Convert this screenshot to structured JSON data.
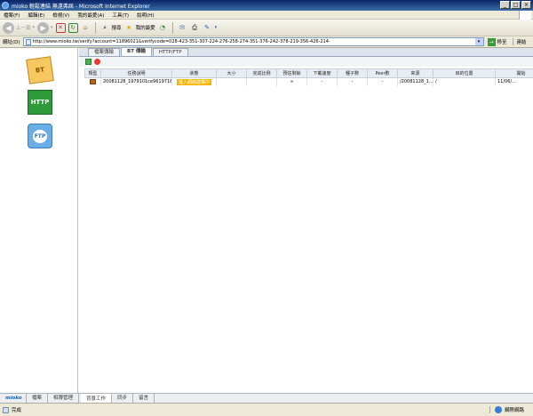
{
  "window": {
    "title": "mioko 輕鬆連結 無遠弗屆 - Microsoft Internet Explorer"
  },
  "menu": [
    "檔案(F)",
    "編輯(E)",
    "檢視(V)",
    "我的最愛(A)",
    "工具(T)",
    "說明(H)"
  ],
  "toolbar": {
    "back": "上一頁",
    "search": "搜尋",
    "favorites": "我的最愛"
  },
  "address": {
    "label": "網址(D)",
    "url": "http://www.mioko.tw/verify?account=11896021&verifycode=028-423-351-307-224-276-258-274-351-376-242-378-219-356-426-214-",
    "go": "移至",
    "links": "連結"
  },
  "sidebar": [
    "BT",
    "HTTP",
    "FTP"
  ],
  "tabs": [
    "檔案傳輸",
    "BT 傳輸",
    "HTTP/FTP"
  ],
  "table": {
    "columns": [
      "類型",
      "任務說明",
      "狀態",
      "大小",
      "完成比例",
      "預估剩餘",
      "下載速度",
      "種子數",
      "Peer數",
      "來源",
      "目的位置",
      "開始"
    ],
    "rows": [
      {
        "name": "20081128_1979101ce9619718...",
        "status": "進入網絡建構中",
        "size": "",
        "progress": "",
        "remaining": "∞",
        "speed": "-",
        "seeds": "-",
        "peers": "-",
        "source": "/20081128_1...",
        "dest": "/",
        "start": "11/06/..."
      }
    ]
  },
  "bottom_tabs": [
    "mioko",
    "檔案",
    "相簿管理",
    "背景工作",
    "同步",
    "留言"
  ],
  "status": {
    "text": "完成",
    "zone": "網際網路"
  }
}
